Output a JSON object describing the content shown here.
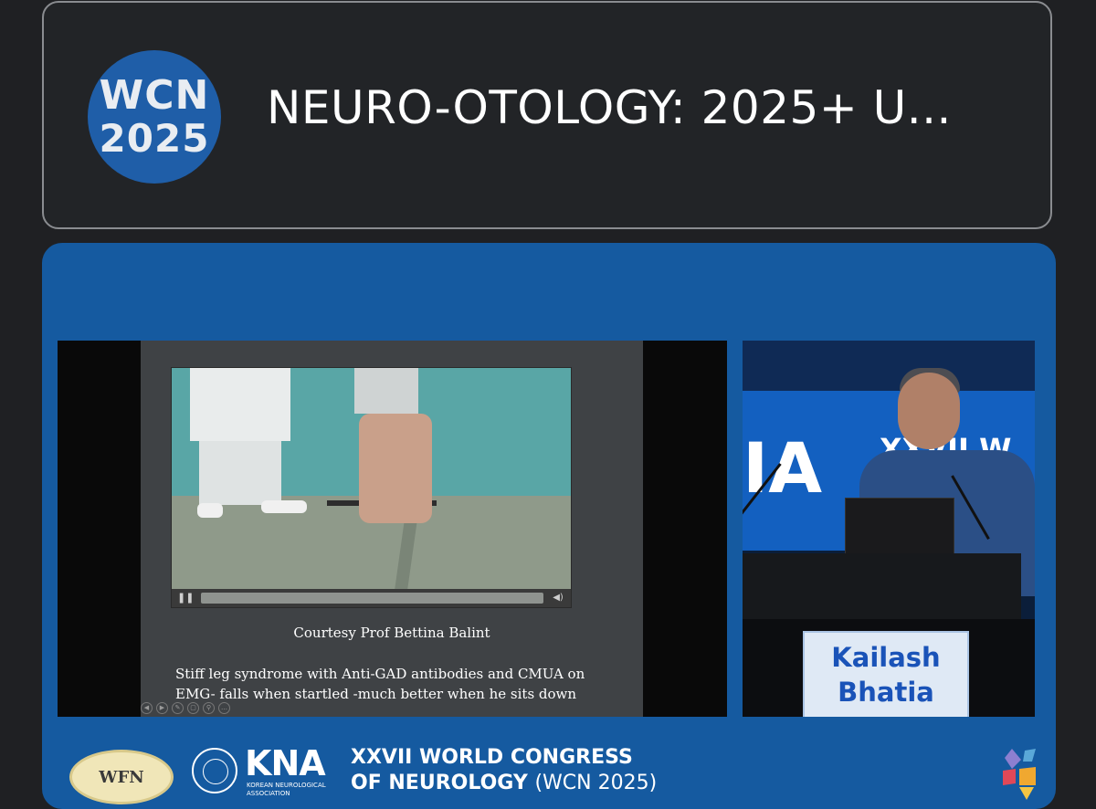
{
  "header": {
    "logo_line1": "WCN",
    "logo_line2": "2025",
    "title": "NEURO-OTOLOGY: 2025+ U..."
  },
  "slide": {
    "courtesy": "Courtesy Prof Bettina Balint",
    "caption_line1": "Stiff leg syndrome with Anti-GAD antibodies and CMUA on",
    "caption_line2": "EMG- falls when startled -much better when he sits down",
    "video_controls": {
      "pause_icon": "pause-icon",
      "volume_icon": "volume-icon"
    }
  },
  "speaker": {
    "stage_text_left": "IA",
    "stage_text_right": "XXVII W",
    "name_line1": "Kailash",
    "name_line2": "Bhatia"
  },
  "footer": {
    "wfn_logo": "WFN",
    "kna_logo": "KNA",
    "kna_subtitle": "KOREAN NEUROLOGICAL ASSOCIATION",
    "congress_line1": "XXVII WORLD CONGRESS",
    "congress_line2": "OF NEUROLOGY",
    "congress_line2_suffix": "(WCN 2025)"
  },
  "colors": {
    "background": "#1f2023",
    "panel_blue": "#155aa0",
    "name_plate_text": "#1a53b8"
  }
}
